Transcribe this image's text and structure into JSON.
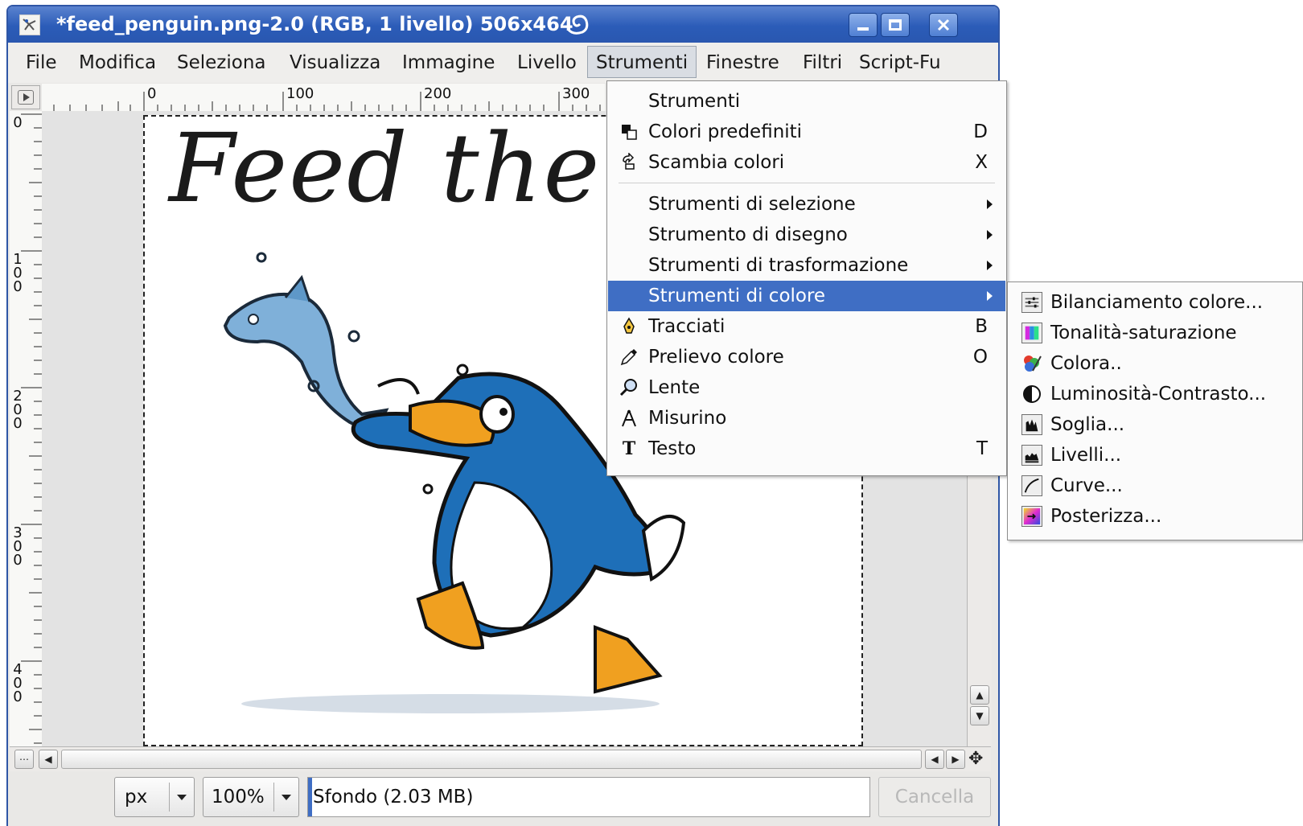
{
  "window": {
    "title": "*feed_penguin.png-2.0 (RGB, 1 livello) 506x464",
    "controls": [
      "minimize",
      "maximize",
      "close"
    ]
  },
  "menubar": {
    "items": [
      "File",
      "Modifica",
      "Seleziona",
      "Visualizza",
      "Immagine",
      "Livello",
      "Strumenti",
      "Finestre",
      "Filtri",
      "Script-Fu"
    ],
    "active": "Strumenti"
  },
  "ruler": {
    "horizontal_labels": [
      "0",
      "100",
      "200",
      "300"
    ],
    "vertical_labels": [
      "0",
      "100",
      "200",
      "300",
      "400"
    ]
  },
  "image": {
    "heading_text": "Feed the pe"
  },
  "tools_menu": {
    "items": [
      {
        "label": "Strumenti",
        "shortcut": "",
        "icon": "none"
      },
      {
        "label": "Colori predefiniti",
        "shortcut": "D",
        "icon": "default-colors-icon"
      },
      {
        "label": "Scambia colori",
        "shortcut": "X",
        "icon": "swap-colors-icon"
      },
      {
        "label": "Strumenti di selezione",
        "shortcut": "",
        "submenu": true
      },
      {
        "label": "Strumento di disegno",
        "shortcut": "",
        "submenu": true
      },
      {
        "label": "Strumenti di trasformazione",
        "shortcut": "",
        "submenu": true
      },
      {
        "label": "Strumenti di colore",
        "shortcut": "",
        "submenu": true,
        "highlighted": true
      },
      {
        "label": "Tracciati",
        "shortcut": "B",
        "icon": "paths-icon"
      },
      {
        "label": "Prelievo colore",
        "shortcut": "O",
        "icon": "color-picker-icon"
      },
      {
        "label": "Lente",
        "shortcut": "",
        "icon": "magnify-icon"
      },
      {
        "label": "Misurino",
        "shortcut": "",
        "icon": "measure-icon"
      },
      {
        "label": "Testo",
        "shortcut": "T",
        "icon": "text-icon"
      }
    ]
  },
  "color_tools_submenu": {
    "items": [
      {
        "label": "Bilanciamento colore...",
        "icon": "color-balance-icon"
      },
      {
        "label": "Tonalità-saturazione",
        "icon": "hue-saturation-icon"
      },
      {
        "label": "Colora..",
        "icon": "colorize-icon"
      },
      {
        "label": "Luminosità-Contrasto...",
        "icon": "brightness-contrast-icon"
      },
      {
        "label": "Soglia...",
        "icon": "threshold-icon"
      },
      {
        "label": "Livelli...",
        "icon": "levels-icon"
      },
      {
        "label": "Curve...",
        "icon": "curves-icon"
      },
      {
        "label": "Posterizza...",
        "icon": "posterize-icon"
      }
    ]
  },
  "statusbar": {
    "unit": "px",
    "zoom": "100%",
    "message": "Sfondo (2.03 MB)",
    "cancel_label": "Cancella"
  },
  "colors": {
    "titlebar": "#2b5cb8",
    "highlight": "#3f6ec4",
    "penguin_blue": "#1e6fb8",
    "beak_orange": "#f0a020"
  }
}
